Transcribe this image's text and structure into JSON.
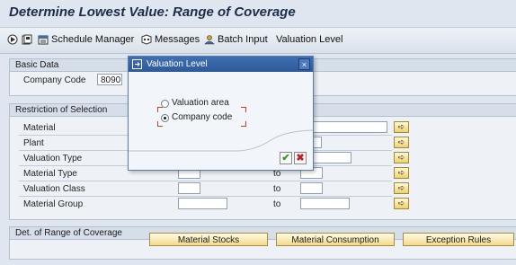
{
  "title": "Determine Lowest Value: Range of Coverage",
  "toolbar": {
    "schedule_manager": "Schedule Manager",
    "messages": "Messages",
    "batch_input": "Batch Input",
    "valuation_level": "Valuation Level"
  },
  "basic_data": {
    "header": "Basic Data",
    "company_code_label": "Company Code",
    "company_code_value": "8090"
  },
  "restriction": {
    "header": "Restriction of Selection",
    "rows": [
      {
        "label": "Material"
      },
      {
        "label": "Plant"
      },
      {
        "label": "Valuation Type"
      },
      {
        "label": "Material Type"
      },
      {
        "label": "Valuation Class"
      },
      {
        "label": "Material Group"
      }
    ],
    "to_label": "to"
  },
  "det": {
    "header": "Det. of Range of Coverage",
    "buttons": [
      "Material Stocks",
      "Material Consumption",
      "Exception Rules"
    ]
  },
  "dialog": {
    "title": "Valuation Level",
    "option_1": "Valuation area",
    "option_2": "Company code",
    "selected": "Company code",
    "close_glyph": "×",
    "ok_glyph": "✔",
    "cancel_glyph": "✖"
  }
}
